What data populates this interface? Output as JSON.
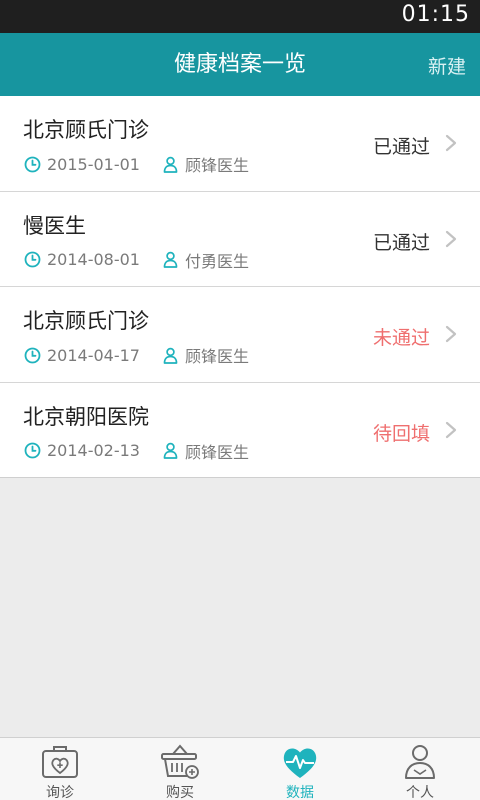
{
  "status_bar": {
    "time": "01:15"
  },
  "header": {
    "title": "健康档案一览",
    "new_label": "新建"
  },
  "colors": {
    "accent": "#17959f",
    "tab_active": "#1fb3bd",
    "status_passed": "#333333",
    "status_alert": "#ef6f6f"
  },
  "records": [
    {
      "title": "北京顾氏门诊",
      "date": "2015-01-01",
      "doctor": "顾锋医生",
      "status": "已通过",
      "status_type": "passed"
    },
    {
      "title": "慢医生",
      "date": "2014-08-01",
      "doctor": "付勇医生",
      "status": "已通过",
      "status_type": "passed"
    },
    {
      "title": "北京顾氏门诊",
      "date": "2014-04-17",
      "doctor": "顾锋医生",
      "status": "未通过",
      "status_type": "alert"
    },
    {
      "title": "北京朝阳医院",
      "date": "2014-02-13",
      "doctor": "顾锋医生",
      "status": "待回填",
      "status_type": "alert"
    }
  ],
  "tabbar": [
    {
      "label": "询诊",
      "icon": "medical-kit-icon",
      "active": false
    },
    {
      "label": "购买",
      "icon": "shopping-basket-icon",
      "active": false
    },
    {
      "label": "数据",
      "icon": "heart-pulse-icon",
      "active": true
    },
    {
      "label": "个人",
      "icon": "person-icon",
      "active": false
    }
  ]
}
